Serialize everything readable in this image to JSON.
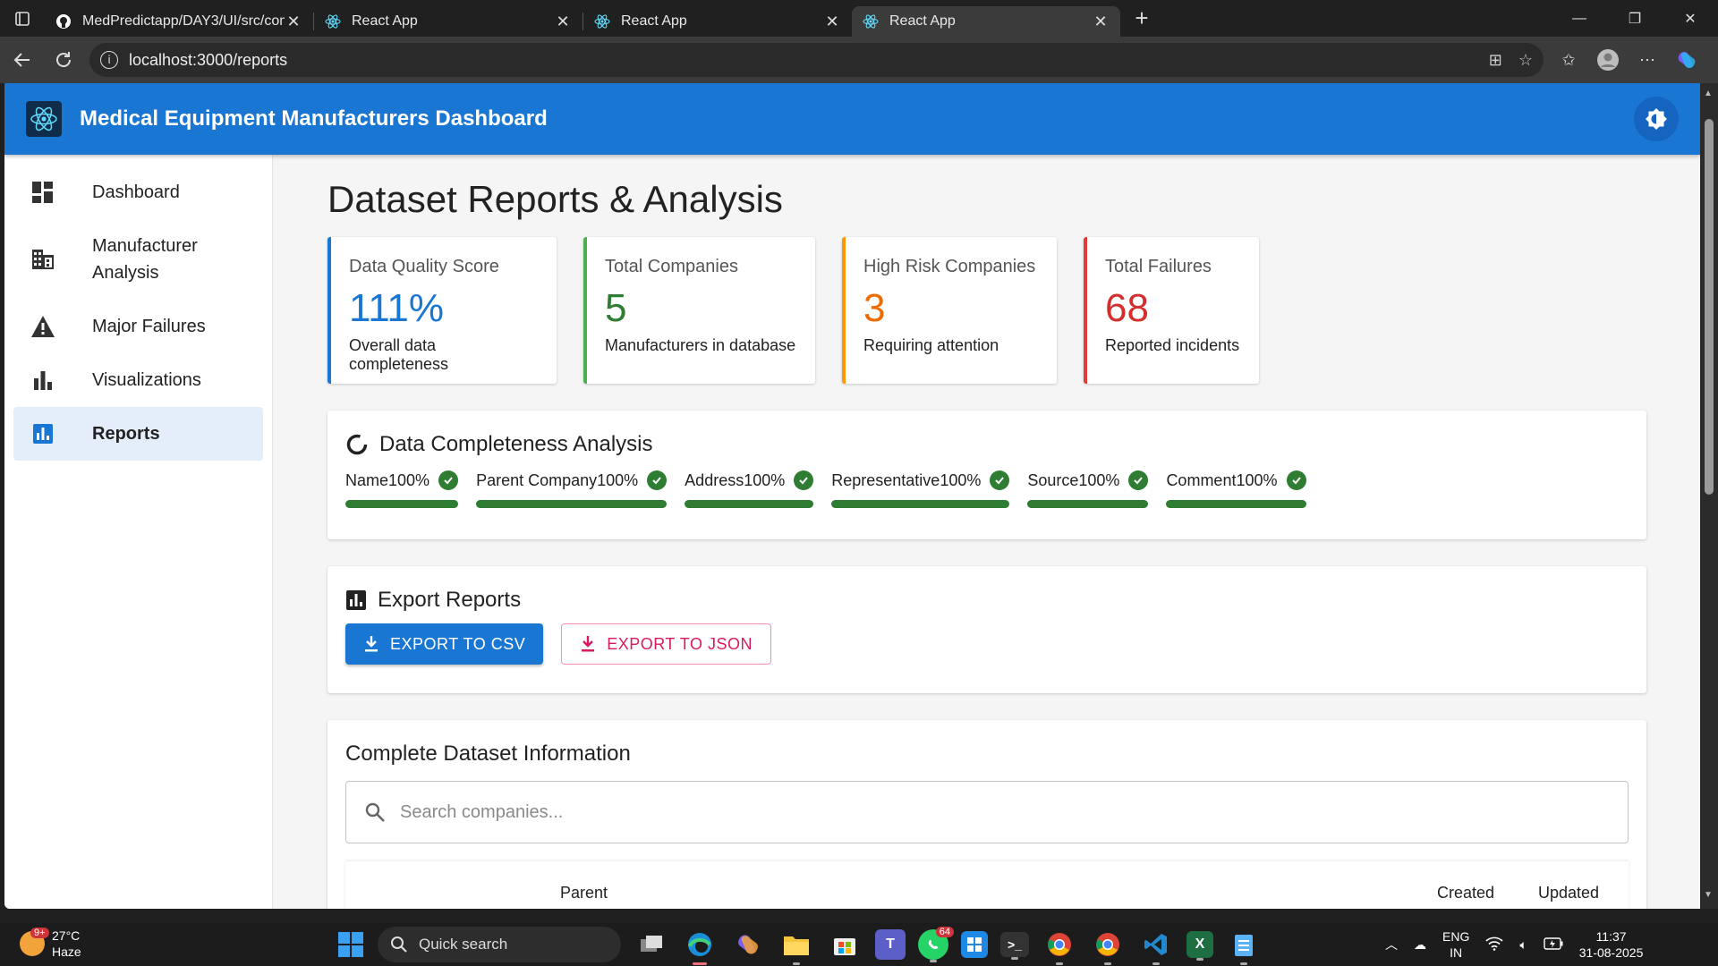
{
  "browser": {
    "tabs": [
      {
        "title": "MedPredictapp/DAY3/UI/src/com",
        "active": false
      },
      {
        "title": "React App",
        "active": false
      },
      {
        "title": "React App",
        "active": false
      },
      {
        "title": "React App",
        "active": true
      }
    ],
    "url": "localhost:3000/reports"
  },
  "app": {
    "title": "Medical Equipment Manufacturers Dashboard",
    "brand_color": "#1976d2"
  },
  "sidebar": {
    "items": [
      {
        "label": "Dashboard",
        "icon": "dashboard-icon",
        "active": false
      },
      {
        "label": "Manufacturer Analysis",
        "icon": "business-icon",
        "active": false
      },
      {
        "label": "Major Failures",
        "icon": "warning-icon",
        "active": false
      },
      {
        "label": "Visualizations",
        "icon": "bar-chart-icon",
        "active": false
      },
      {
        "label": "Reports",
        "icon": "assessment-icon",
        "active": true
      }
    ]
  },
  "page": {
    "title": "Dataset Reports & Analysis"
  },
  "stats": [
    {
      "label": "Data Quality Score",
      "value": "111%",
      "sub": "Overall data completeness",
      "color": "#1976d2"
    },
    {
      "label": "Total Companies",
      "value": "5",
      "sub": "Manufacturers in database",
      "color": "#2e7d32"
    },
    {
      "label": "High Risk Companies",
      "value": "3",
      "sub": "Requiring attention",
      "color": "#ed6c02"
    },
    {
      "label": "Total Failures",
      "value": "68",
      "sub": "Reported incidents",
      "color": "#d32f2f"
    }
  ],
  "completeness": {
    "title": "Data Completeness Analysis",
    "fields": [
      {
        "label": "Name100%",
        "percent": 100
      },
      {
        "label": "Parent Company100%",
        "percent": 100
      },
      {
        "label": "Address100%",
        "percent": 100
      },
      {
        "label": "Representative100%",
        "percent": 100
      },
      {
        "label": "Source100%",
        "percent": 100
      },
      {
        "label": "Comment100%",
        "percent": 100
      }
    ],
    "bar_color": "#2e7d32"
  },
  "export": {
    "title": "Export Reports",
    "csv_label": "EXPORT TO CSV",
    "json_label": "EXPORT TO JSON"
  },
  "dataset": {
    "title": "Complete Dataset Information",
    "search_placeholder": "Search companies...",
    "columns": [
      "Parent",
      "Created",
      "Updated"
    ]
  },
  "taskbar": {
    "weather_temp": "27°C",
    "weather_desc": "Haze",
    "weather_badge": "9+",
    "search_label": "Quick search",
    "whatsapp_count": "64",
    "lang_line1": "ENG",
    "lang_line2": "IN",
    "time": "11:37",
    "date": "31-08-2025"
  }
}
